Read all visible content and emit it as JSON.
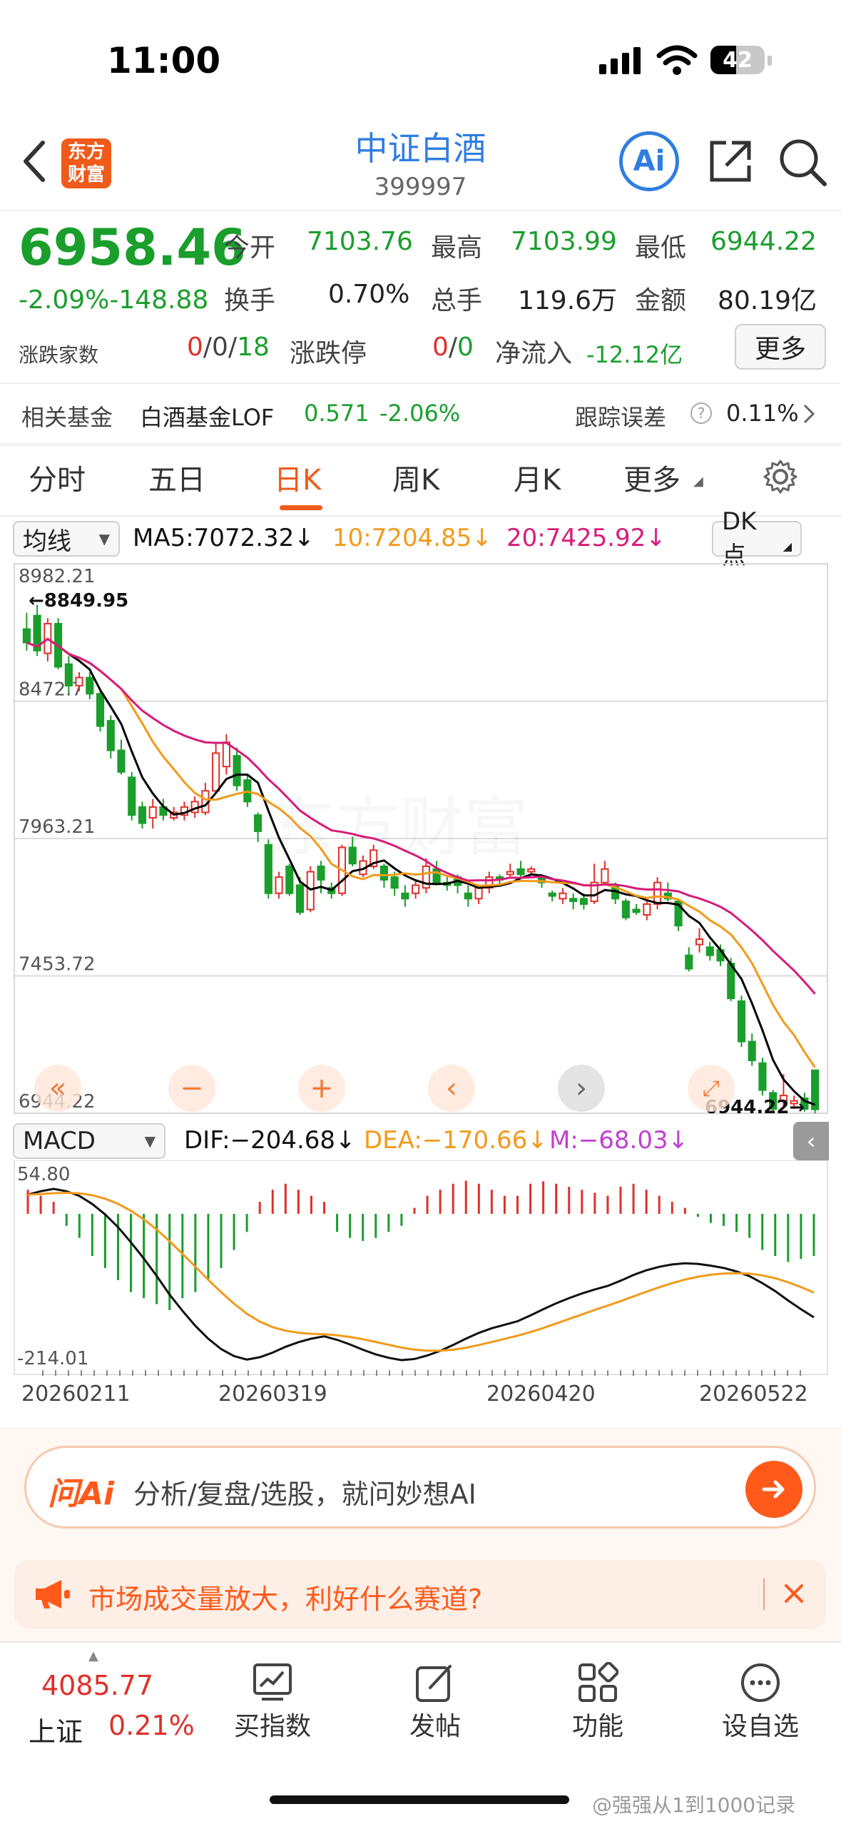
{
  "status_bar": {
    "time": "11:00",
    "battery": "42"
  },
  "header": {
    "logo_line1": "东方",
    "logo_line2": "财富",
    "title": "中证白酒",
    "code": "399997",
    "ai_label": "Ai"
  },
  "quote": {
    "price": "6958.46",
    "change": "-2.09%-148.88",
    "open_label": "今开",
    "open": "7103.76",
    "high_label": "最高",
    "high": "7103.99",
    "low_label": "最低",
    "low": "6944.22",
    "turnover_label": "换手",
    "turnover": "0.70%",
    "volume_label": "总手",
    "volume": "119.6万",
    "amount_label": "金额",
    "amount": "80.19亿",
    "updown_label": "涨跌家数",
    "updown_a": "0",
    "updown_b": "/0/",
    "updown_c": "18",
    "limit_label": "涨跌停",
    "limit_a": "0",
    "limit_b": "/",
    "limit_c": "0",
    "netflow_label": "净流入",
    "netflow": "-12.12亿",
    "more_label": "更多"
  },
  "fund": {
    "label": "相关基金",
    "name": "白酒基金LOF",
    "price": "0.571",
    "change": "-2.06%",
    "track_label": "跟踪误差",
    "track_help": "?",
    "track_value": "0.11%"
  },
  "tabs": [
    "分时",
    "五日",
    "日K",
    "周K",
    "月K",
    "更多"
  ],
  "active_tab": "日K",
  "ma_bar": {
    "selector": "均线",
    "ma5": "MA5:7072.32↓",
    "ma10": "10:7204.85↓",
    "ma20": "20:7425.92↓",
    "dk": "DK点"
  },
  "macd_bar": {
    "selector": "MACD",
    "dif": "DIF:−204.68↓",
    "dea": "DEA:−170.66↓",
    "m": "M:−68.03↓"
  },
  "colors": {
    "up": "#e0302a",
    "down": "#1a9e2c",
    "ma5": "#000000",
    "ma10": "#f29a1b",
    "ma20": "#d81b7a",
    "accent": "#2f7de1",
    "ai_orange": "#ff6a1a"
  },
  "chart_data": [
    {
      "type": "candlestick",
      "price_labels": [
        "8982.21",
        "8472.7",
        "7963.21",
        "7453.72",
        "6944.22"
      ],
      "ylim": [
        6944.22,
        8982.21
      ],
      "annotations": {
        "max_label": "←8849.95",
        "min_label": "6944.22→"
      },
      "dates": [
        "20260211",
        "20260319",
        "20260420",
        "20260522"
      ],
      "candles": [
        [
          8740,
          8690,
          8800,
          8660
        ],
        [
          8790,
          8660,
          8830,
          8640
        ],
        [
          8650,
          8760,
          8780,
          8620
        ],
        [
          8760,
          8600,
          8780,
          8590
        ],
        [
          8610,
          8530,
          8640,
          8500
        ],
        [
          8530,
          8560,
          8580,
          8510
        ],
        [
          8560,
          8500,
          8580,
          8480
        ],
        [
          8500,
          8380,
          8520,
          8360
        ],
        [
          8400,
          8290,
          8420,
          8260
        ],
        [
          8290,
          8210,
          8330,
          8200
        ],
        [
          8190,
          8050,
          8210,
          8030
        ],
        [
          8080,
          8020,
          8100,
          8000
        ],
        [
          8040,
          8080,
          8110,
          8000
        ],
        [
          8080,
          8050,
          8110,
          8030
        ],
        [
          8040,
          8060,
          8080,
          8030
        ],
        [
          8050,
          8080,
          8100,
          8030
        ],
        [
          8060,
          8100,
          8120,
          8040
        ],
        [
          8060,
          8140,
          8170,
          8050
        ],
        [
          8140,
          8280,
          8320,
          8130
        ],
        [
          8230,
          8320,
          8350,
          8200
        ],
        [
          8270,
          8160,
          8300,
          8140
        ],
        [
          8180,
          8100,
          8200,
          8080
        ],
        [
          8050,
          7990,
          8060,
          7950
        ],
        [
          7940,
          7760,
          7960,
          7740
        ],
        [
          7760,
          7820,
          7840,
          7740
        ],
        [
          7860,
          7760,
          7870,
          7750
        ],
        [
          7790,
          7690,
          7820,
          7680
        ],
        [
          7700,
          7840,
          7860,
          7690
        ],
        [
          7860,
          7810,
          7880,
          7760
        ],
        [
          7780,
          7760,
          7800,
          7740
        ],
        [
          7760,
          7930,
          7940,
          7750
        ],
        [
          7930,
          7870,
          7970,
          7860
        ],
        [
          7830,
          7880,
          7900,
          7820
        ],
        [
          7860,
          7920,
          7940,
          7850
        ],
        [
          7860,
          7810,
          7870,
          7780
        ],
        [
          7820,
          7780,
          7840,
          7750
        ],
        [
          7760,
          7740,
          7790,
          7710
        ],
        [
          7760,
          7790,
          7810,
          7740
        ],
        [
          7780,
          7860,
          7890,
          7760
        ],
        [
          7850,
          7800,
          7880,
          7790
        ],
        [
          7800,
          7790,
          7820,
          7770
        ],
        [
          7820,
          7790,
          7830,
          7760
        ],
        [
          7760,
          7740,
          7790,
          7710
        ],
        [
          7740,
          7780,
          7790,
          7720
        ],
        [
          7780,
          7820,
          7840,
          7760
        ],
        [
          7820,
          7810,
          7830,
          7790
        ],
        [
          7830,
          7840,
          7870,
          7820
        ],
        [
          7850,
          7830,
          7880,
          7820
        ],
        [
          7840,
          7850,
          7860,
          7830
        ],
        [
          7820,
          7800,
          7830,
          7780
        ],
        [
          7760,
          7750,
          7770,
          7730
        ],
        [
          7740,
          7760,
          7780,
          7720
        ],
        [
          7740,
          7730,
          7760,
          7700
        ],
        [
          7740,
          7720,
          7760,
          7700
        ],
        [
          7730,
          7800,
          7870,
          7720
        ],
        [
          7800,
          7850,
          7880,
          7790
        ],
        [
          7790,
          7740,
          7800,
          7720
        ],
        [
          7730,
          7670,
          7740,
          7660
        ],
        [
          7700,
          7690,
          7720,
          7680
        ],
        [
          7680,
          7720,
          7730,
          7660
        ],
        [
          7720,
          7800,
          7820,
          7700
        ],
        [
          7760,
          7740,
          7800,
          7730
        ],
        [
          7730,
          7640,
          7740,
          7620
        ],
        [
          7530,
          7480,
          7560,
          7470
        ],
        [
          7570,
          7590,
          7630,
          7540
        ],
        [
          7560,
          7530,
          7580,
          7510
        ],
        [
          7550,
          7510,
          7570,
          7490
        ],
        [
          7500,
          7370,
          7520,
          7360
        ],
        [
          7360,
          7210,
          7380,
          7190
        ],
        [
          7210,
          7140,
          7240,
          7120
        ],
        [
          7130,
          7030,
          7150,
          7010
        ],
        [
          7020,
          6960,
          7030,
          6950
        ],
        [
          6990,
          7010,
          7090,
          6970
        ],
        [
          6980,
          6990,
          7010,
          6960
        ],
        [
          7000,
          6960,
          7020,
          6950
        ],
        [
          7103.76,
          6958.46,
          7103.99,
          6944.22
        ]
      ]
    },
    {
      "type": "bar",
      "name": "MACD",
      "tick_labels": [
        "54.80",
        "-214.01"
      ],
      "ylim": [
        -214.01,
        54.8
      ],
      "histogram": [
        40,
        30,
        20,
        -20,
        -40,
        -70,
        -90,
        -110,
        -130,
        -140,
        -150,
        -160,
        -140,
        -130,
        -110,
        -90,
        -60,
        -30,
        20,
        40,
        50,
        40,
        30,
        20,
        -30,
        -40,
        -45,
        -40,
        -30,
        -20,
        10,
        30,
        40,
        50,
        55,
        50,
        40,
        30,
        30,
        50,
        54,
        50,
        45,
        40,
        35,
        30,
        45,
        50,
        40,
        30,
        20,
        10,
        -5,
        -15,
        -20,
        -30,
        -40,
        -60,
        -70,
        -80,
        -75,
        -70
      ]
    }
  ],
  "ai_bar": {
    "logo": "问Ai",
    "placeholder": "分析/复盘/选股，就问妙想AI"
  },
  "notice": {
    "text": "市场成交量放大，利好什么赛道?"
  },
  "bottom_nav": {
    "index_value": "4085.77",
    "index_name": "上证",
    "index_change": "0.21%",
    "items": [
      "买指数",
      "发帖",
      "功能",
      "设自选"
    ]
  },
  "watermark": "@强强从1到1000记录"
}
